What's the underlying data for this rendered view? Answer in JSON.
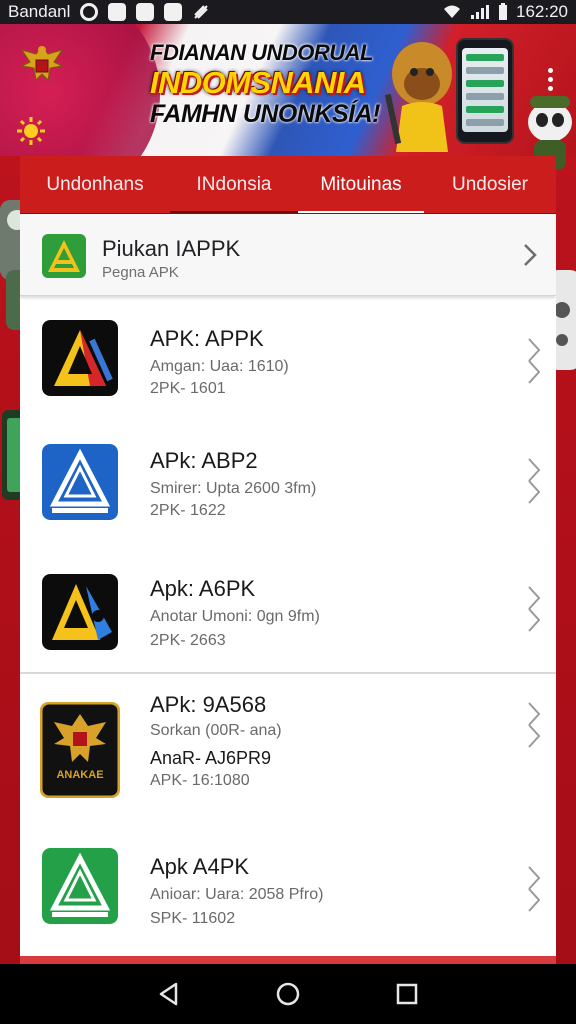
{
  "status_bar": {
    "carrier": "Bandanl",
    "time": "162:20"
  },
  "banner": {
    "line1": "FDIANAN UNDORUAL",
    "line2": "INDOMSNANIA",
    "line3": "FAMHN UNONKSÍA!"
  },
  "tabs": [
    {
      "label": "Undonhans"
    },
    {
      "label": "INdonsia"
    },
    {
      "label": "Mitouinas"
    },
    {
      "label": "Undosier"
    }
  ],
  "header": {
    "title": "Piukan IAPPK",
    "subtitle": "Pegna APK"
  },
  "items": [
    {
      "title": "APK: APPK",
      "subtitle": "Amgan: Uaa: 1610)",
      "meta": "2PK- 1601"
    },
    {
      "title": "APk: ABP2",
      "subtitle": "Smirer: Upta 2600 3fm)",
      "meta": "2PK- 1622"
    },
    {
      "title": "Apk: A6PK",
      "subtitle": "Anotar Umoni: 0gn 9fm)",
      "meta": "2PK- 2663"
    },
    {
      "title": "APk: 9A568",
      "subtitle": "Sorkan (00R- ana)",
      "extra": "AnaR- AJ6PR9",
      "meta": "APK- 16:1080",
      "icon_text": "ANAKAE"
    },
    {
      "title": "Apk A4PK",
      "subtitle": "Anioar: Uara: 2058 Pfro)",
      "meta": "SPK- 11602"
    }
  ],
  "icons": {
    "emblem": "garuda-emblem-icon",
    "sun": "sun-icon",
    "menu": "more-vert-icon",
    "header_app": "apk-triangle-icon",
    "chevron": "chevron-right-icon",
    "back": "back-icon",
    "home": "home-icon",
    "recents": "recents-icon"
  },
  "colors": {
    "tab_bar": "#cc1d1d",
    "background": "#b5121b",
    "accent_yellow": "#ffd400"
  }
}
